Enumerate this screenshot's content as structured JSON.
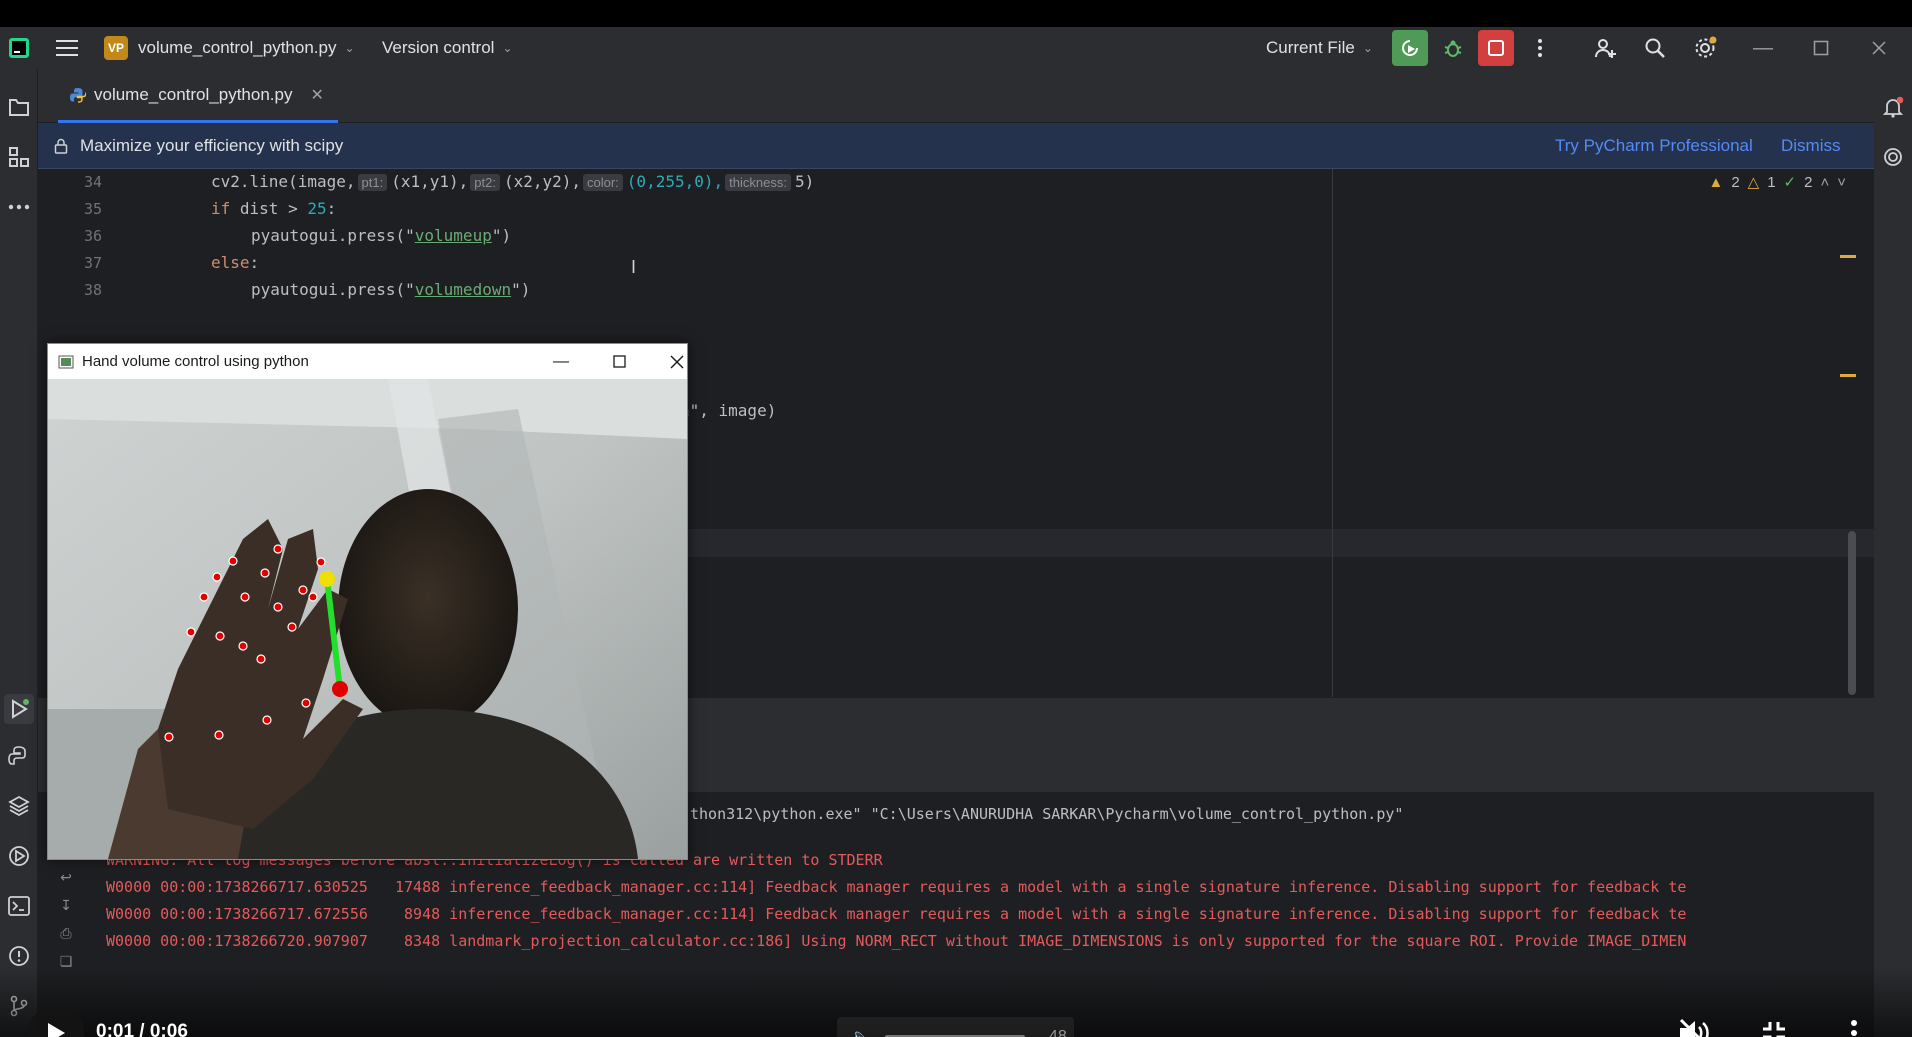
{
  "topbar": {
    "project_badge": "VP",
    "project_name": "volume_control_python.py",
    "vcs": "Version control",
    "run_config": "Current File"
  },
  "tab": {
    "filename": "volume_control_python.py"
  },
  "banner": {
    "message": "Maximize your efficiency with scipy",
    "try_pro": "Try PyCharm Professional",
    "dismiss": "Dismiss"
  },
  "inspections": {
    "warnings": "2",
    "weak_warnings": "1",
    "ok": "2"
  },
  "editor": {
    "lines": [
      {
        "no": "34"
      },
      {
        "no": "35"
      },
      {
        "no": "36"
      },
      {
        "no": "37"
      },
      {
        "no": "38"
      }
    ],
    "l34": {
      "a": "cv2.line(image,",
      "h1": "pt1:",
      "b": "(x1,y1),",
      "h2": "pt2:",
      "c": "(x2,y2),",
      "h3": "color:",
      "d": "(0,255,0),",
      "h4": "thickness:",
      "e": "5)"
    },
    "l35": {
      "kw": "if",
      "a": " dist > ",
      "num": "25",
      "b": ":"
    },
    "l36": {
      "a": "pyautogui.press(\"",
      "s": "volumeup",
      "b": "\")"
    },
    "l37": {
      "kw": "else",
      "b": ":"
    },
    "l38": {
      "a": "pyautogui.press(\"",
      "s": "volumedown",
      "b": "\")"
    },
    "partial": "n\", image)"
  },
  "console": {
    "command": "thon312\\python.exe\" \"C:\\Users\\ANURUDHA SARKAR\\Pycharm\\volume_control_python.py\"",
    "lines": [
      "WARNING: All log messages before absl::InitializeLog() is called are written to STDERR",
      "W0000 00:00:1738266717.630525   17488 inference_feedback_manager.cc:114] Feedback manager requires a model with a single signature inference. Disabling support for feedback te",
      "W0000 00:00:1738266717.672556    8948 inference_feedback_manager.cc:114] Feedback manager requires a model with a single signature inference. Disabling support for feedback te",
      "W0000 00:00:1738266720.907907    8348 landmark_projection_calculator.cc:186] Using NORM_RECT without IMAGE_DIMENSIONS is only supported for the square ROI. Provide IMAGE_DIMEN"
    ]
  },
  "popup": {
    "title": "Hand volume control using python"
  },
  "player": {
    "time": "0:01 / 0:06",
    "volume": "48"
  },
  "colors": {
    "accent": "#3574f0",
    "line_green": "#22e02a",
    "landmark_red": "#e00000",
    "tip_yellow": "#f0e000"
  }
}
